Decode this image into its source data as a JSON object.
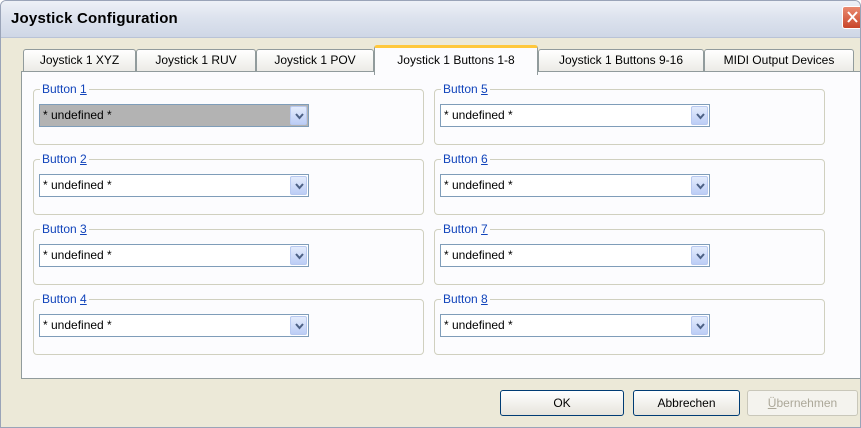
{
  "window": {
    "title": "Joystick Configuration"
  },
  "tabs": [
    {
      "label": "Joystick 1 XYZ"
    },
    {
      "label": "Joystick 1 RUV"
    },
    {
      "label": "Joystick 1 POV"
    },
    {
      "label": "Joystick 1 Buttons 1-8",
      "active": true
    },
    {
      "label": "Joystick 1 Buttons 9-16"
    },
    {
      "label": "MIDI Output Devices"
    }
  ],
  "groups": [
    {
      "label_prefix": "Button ",
      "label_number": "1",
      "value": "* undefined *",
      "selected": true
    },
    {
      "label_prefix": "Button ",
      "label_number": "2",
      "value": "* undefined *"
    },
    {
      "label_prefix": "Button ",
      "label_number": "3",
      "value": "* undefined *"
    },
    {
      "label_prefix": "Button ",
      "label_number": "4",
      "value": "* undefined *"
    },
    {
      "label_prefix": "Button ",
      "label_number": "5",
      "value": "* undefined *"
    },
    {
      "label_prefix": "Button ",
      "label_number": "6",
      "value": "* undefined *"
    },
    {
      "label_prefix": "Button ",
      "label_number": "7",
      "value": "* undefined *"
    },
    {
      "label_prefix": "Button ",
      "label_number": "8",
      "value": "* undefined *"
    }
  ],
  "buttons": {
    "ok": "OK",
    "cancel": "Abbrechen",
    "apply_mnemonic": "Ü",
    "apply_rest": "bernehmen"
  },
  "colors": {
    "tab_highlight": "#ffc83c",
    "group_label": "#1144bb",
    "selected_combo": "#b3b3b3"
  }
}
